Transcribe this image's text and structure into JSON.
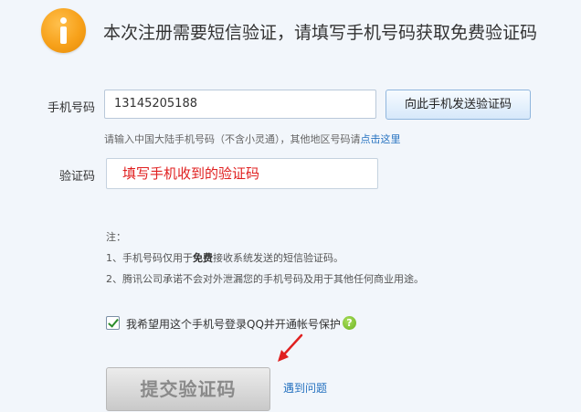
{
  "header": {
    "icon": "info-icon",
    "title": "本次注册需要短信验证，请填写手机号码获取免费验证码"
  },
  "phone": {
    "label": "手机号码",
    "value": "13145205188",
    "send_button": "向此手机发送验证码",
    "hint_prefix": "请输入中国大陆手机号码（不含小灵通），其他地区号码请",
    "hint_link": "点击这里"
  },
  "code": {
    "label": "验证码",
    "placeholder": "填写手机收到的验证码"
  },
  "notes": {
    "title": "注：",
    "line1_prefix": "1、手机号码仅用于",
    "line1_bold": "免费",
    "line1_suffix": "接收系统发送的短信验证码。",
    "line2": "2、腾讯公司承诺不会对外泄漏您的手机号码及用于其他任何商业用途。"
  },
  "checkbox": {
    "checked": true,
    "label": "我希望用这个手机号登录QQ并开通帐号保护",
    "help_icon": "question-icon",
    "help_glyph": "?"
  },
  "footer": {
    "submit": "提交验证码",
    "problem_link": "遇到问题"
  },
  "colors": {
    "background": "#f2f6fb",
    "accent_orange": "#f7a11a",
    "link": "#2672c0",
    "placeholder_red": "#e02020",
    "arrow_red": "#e02020"
  }
}
